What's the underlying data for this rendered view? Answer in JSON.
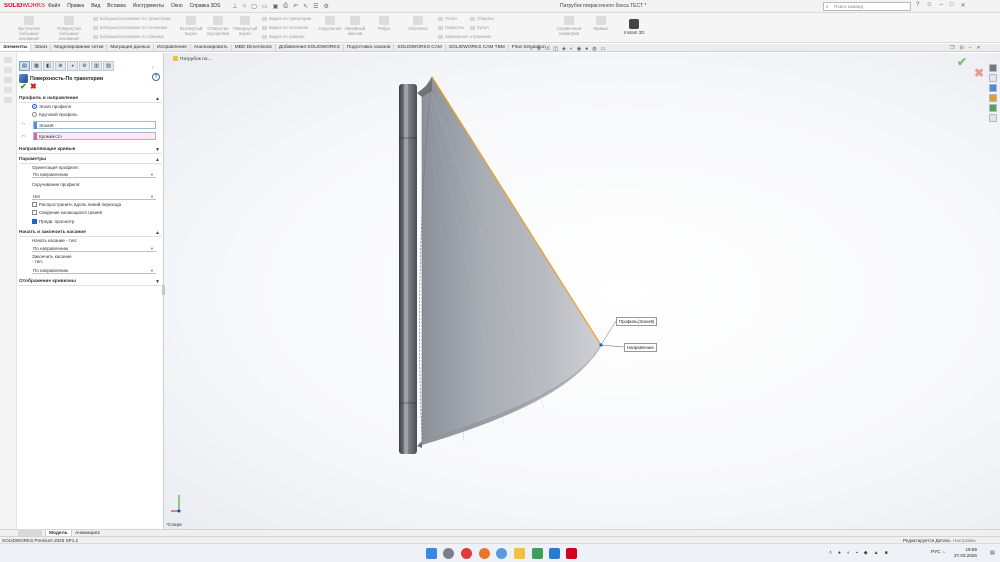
{
  "app": {
    "logo_brand": "SOLID",
    "logo_rest": "WORKS",
    "menu": [
      "Файл",
      "Правка",
      "Вид",
      "Вставка",
      "Инструменты",
      "Окно",
      "Справка 3DS"
    ],
    "document_title": "Патрубок покрасочного бокса TECT *",
    "search_placeholder": "Поиск команд"
  },
  "ribbon": {
    "big_buttons": [
      {
        "label": "Вытянутая бобышка/основание"
      },
      {
        "label": "Повернутая бобышка/основание"
      },
      {
        "label": "Вытянутый вырез"
      },
      {
        "label": "Отверстие под крепеж"
      },
      {
        "label": "Повернутый вырез"
      },
      {
        "label": "Скругление"
      },
      {
        "label": "Линейный массив"
      },
      {
        "label": "Ребро"
      },
      {
        "label": "Оболочка"
      },
      {
        "label": "Справочная геометрия"
      },
      {
        "label": "Кривые"
      }
    ],
    "small_items": [
      "Бобышка/основание по траектории",
      "Бобышка/основание по сечениям",
      "Бобышка/основание по границе",
      "Вырез по траектории",
      "Вырез по сечениям",
      "Вырез по границе",
      "Уклон",
      "Пересечь",
      "Зеркальное отражение",
      "Обертка",
      "Купол"
    ],
    "instant3d": "Instant 3D"
  },
  "cm_tabs": [
    "Элементы",
    "Эскиз",
    "Моделирование сетки",
    "Миграция данных",
    "Исправление",
    "Анализировать",
    "MBD Dimensions",
    "Добавления SOLIDWORKS",
    "Подготовка эскизов",
    "SOLIDWORKS CAM",
    "SOLIDWORKS CAM TBM",
    "Flow Simulation"
  ],
  "property_manager": {
    "title": "Поверхность-По траектории",
    "sections": {
      "profile": "Профиль и направление",
      "guide": "Направляющие кривые",
      "params": "Параметры",
      "tangency": "Начать и закончить касание",
      "curvature": "Отображение кривизны"
    },
    "profile_options": {
      "sketch_profile": "Эскиз профиля",
      "circular_profile": "Круговой профиль"
    },
    "profile_selection": "Эскиз9",
    "path_selection": "Кромка<1>",
    "orientation_label": "Ориентация профиля:",
    "orientation_value": "По направлению",
    "twist_label": "Скручивание профиля:",
    "twist_value": "Нет",
    "options": {
      "propagate": "Распространить вдоль линий перехода",
      "merge": "Сведение касающихся граней",
      "preview": "Предв. просмотр"
    },
    "start_tangent_label": "Начать касание - тип:",
    "start_tangent_value": "По направлению",
    "end_tangent_label": "Закончить касание - тип:",
    "end_tangent_value": "По направлению"
  },
  "viewport": {
    "breadcrumb": "Патрубок по...",
    "callout_profile": "Профиль(Эскиз9)",
    "callout_path": "Направление",
    "view_label": "*Спере"
  },
  "bottom_tabs": [
    "Модель",
    "Анимация1"
  ],
  "status": {
    "version": "SOLIDWORKS Premium 2025 SP1.2",
    "editing": "Редактируется Деталь",
    "custom": "Настройка"
  },
  "taskbar": {
    "lang": "РУС",
    "time": "19:56",
    "date": "27.03.2026"
  },
  "colors": {
    "brand_red": "#d6001c",
    "path_orange": "#f0a020",
    "preview_gray": "#8f949c"
  }
}
